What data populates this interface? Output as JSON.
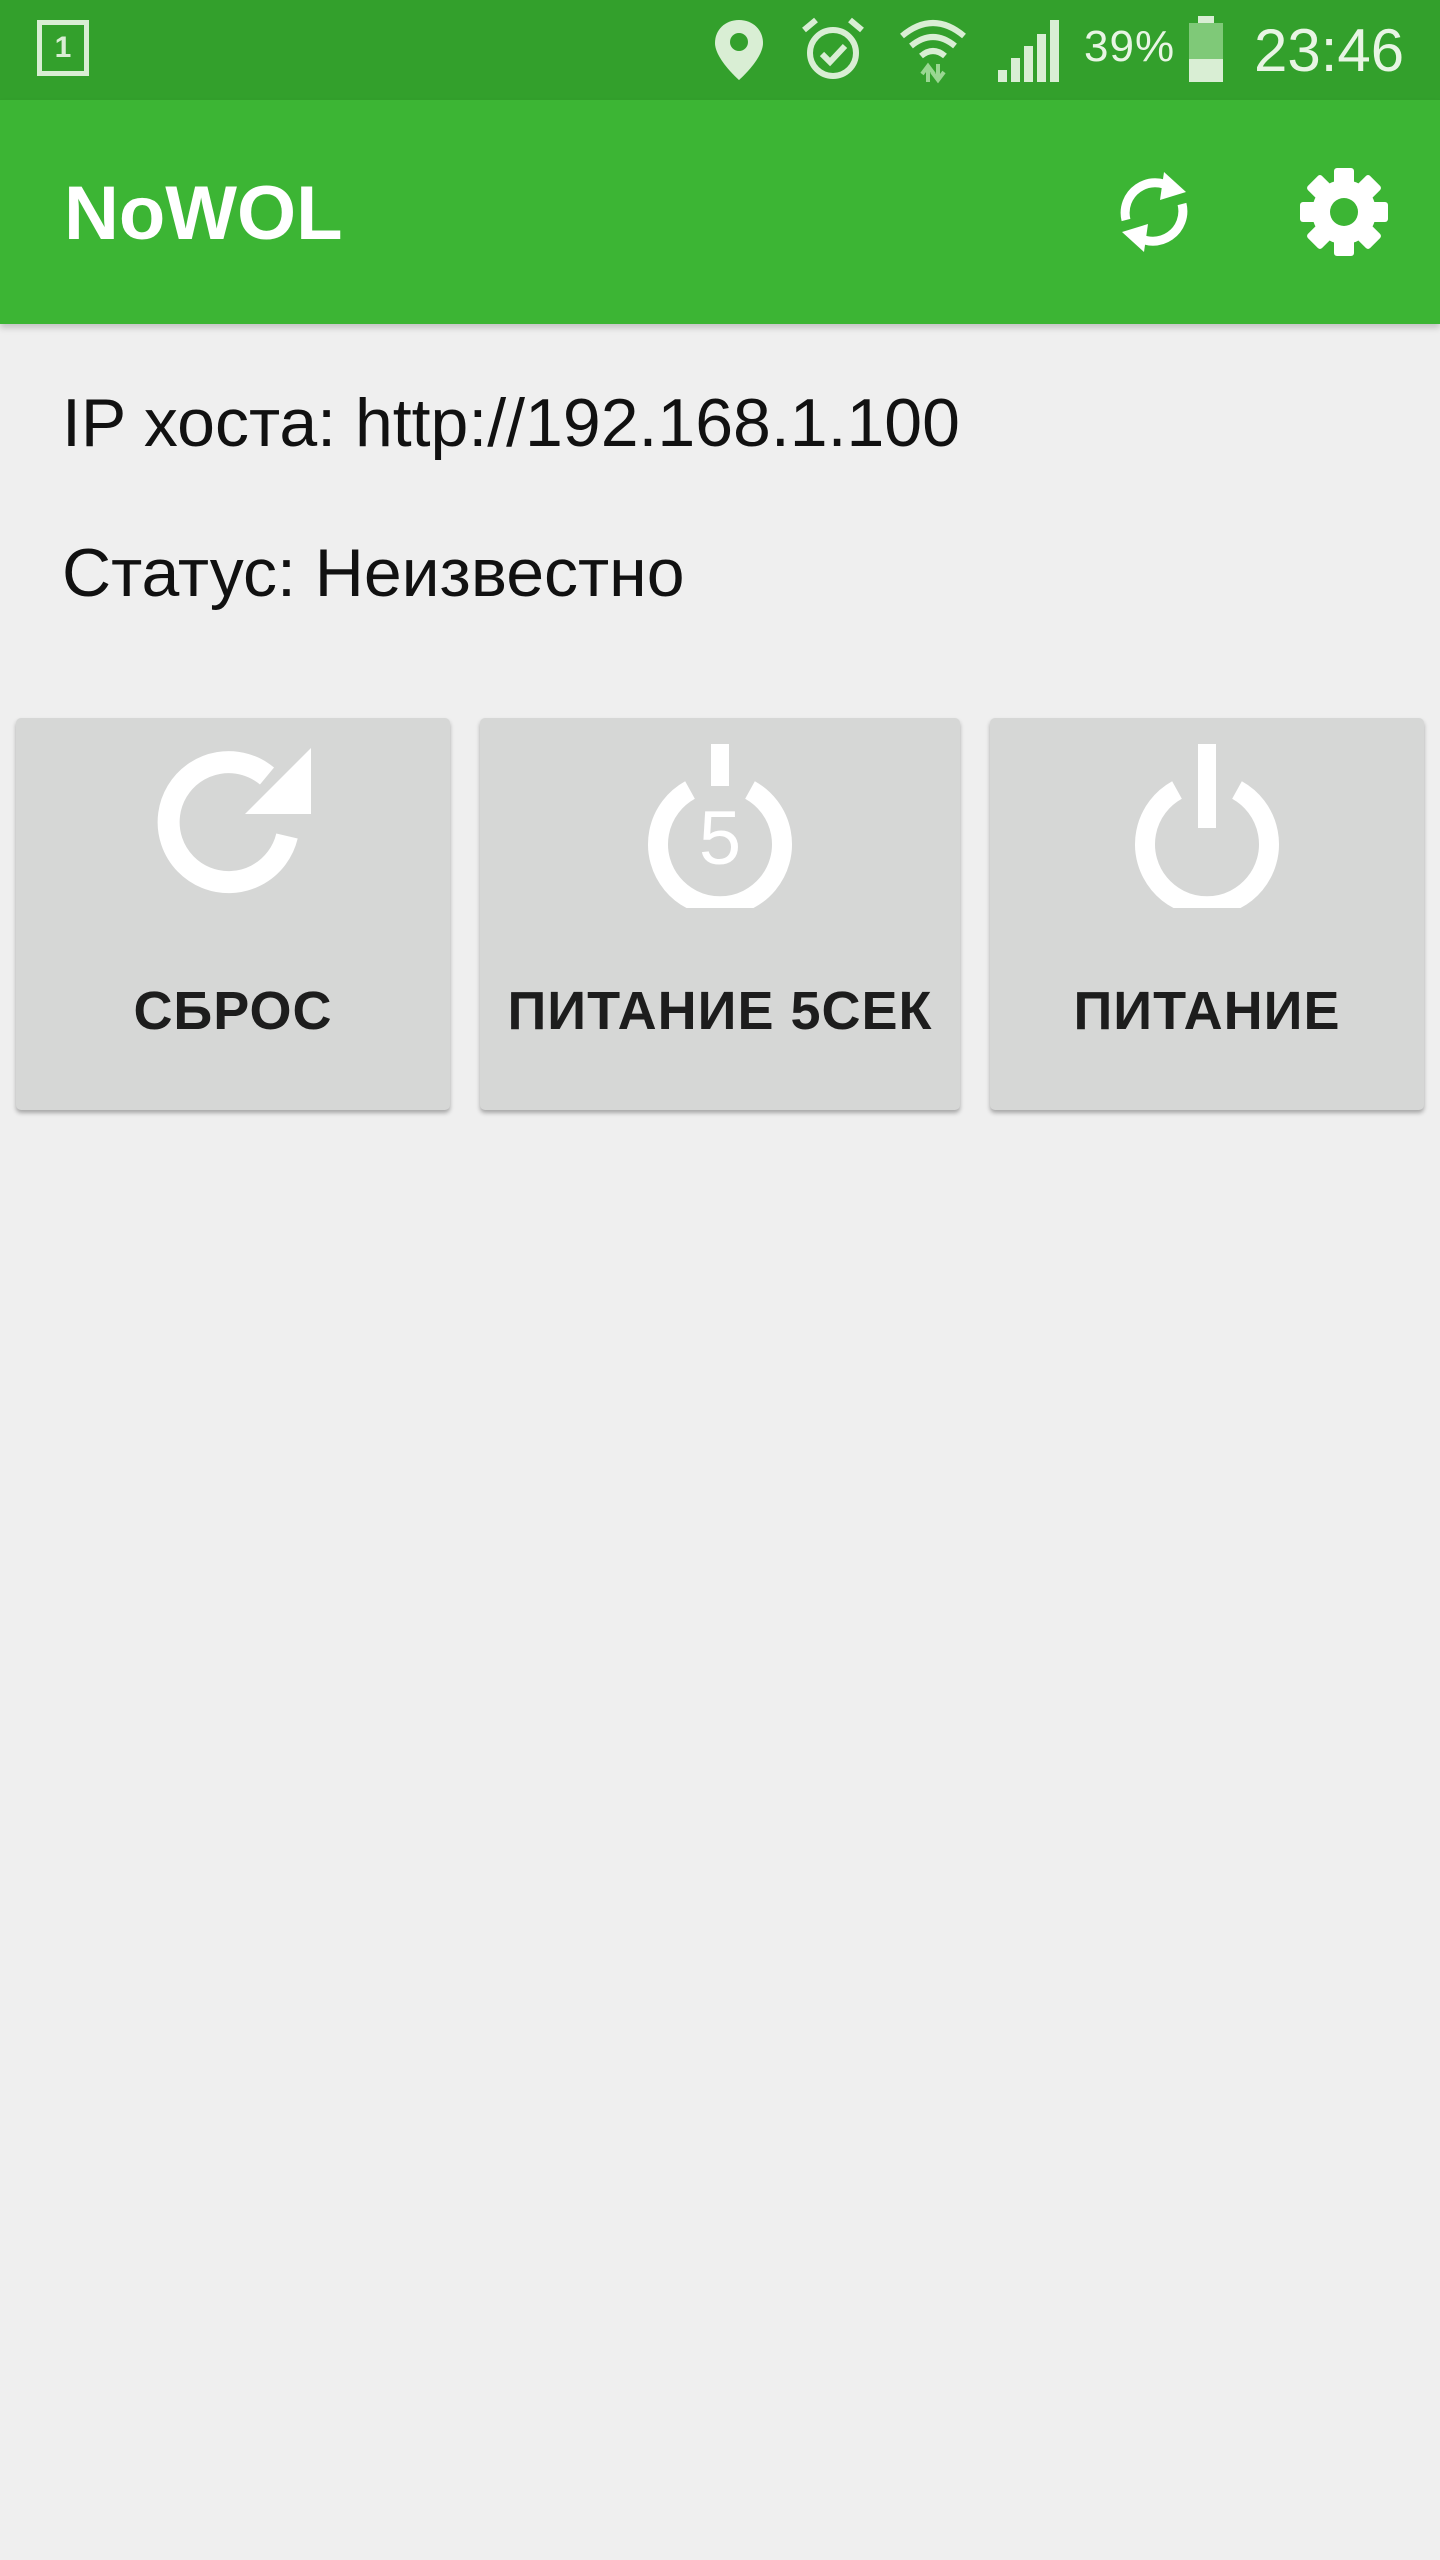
{
  "status_bar": {
    "notification_badge": "1",
    "battery_percent": "39%",
    "time": "23:46",
    "icons": [
      "notification-icon",
      "location-icon",
      "alarm-icon",
      "wifi-icon",
      "signal-icon",
      "battery-icon"
    ]
  },
  "app_bar": {
    "title": "NoWOL",
    "actions": [
      "refresh-icon",
      "settings-icon"
    ]
  },
  "info": {
    "host_ip": "IP хоста: http://192.168.1.100",
    "status": "Статус: Неизвестно"
  },
  "actions": [
    {
      "label": "СБРОС",
      "icon": "reset-icon"
    },
    {
      "label": "ПИТАНИЕ 5СЕК",
      "icon": "power-5s-icon",
      "icon_text": "5"
    },
    {
      "label": "ПИТАНИЕ",
      "icon": "power-icon"
    }
  ],
  "colors": {
    "status_bar": "#33a02c",
    "app_bar": "#3cb534",
    "background": "#efefef",
    "button": "#d6d7d6"
  }
}
